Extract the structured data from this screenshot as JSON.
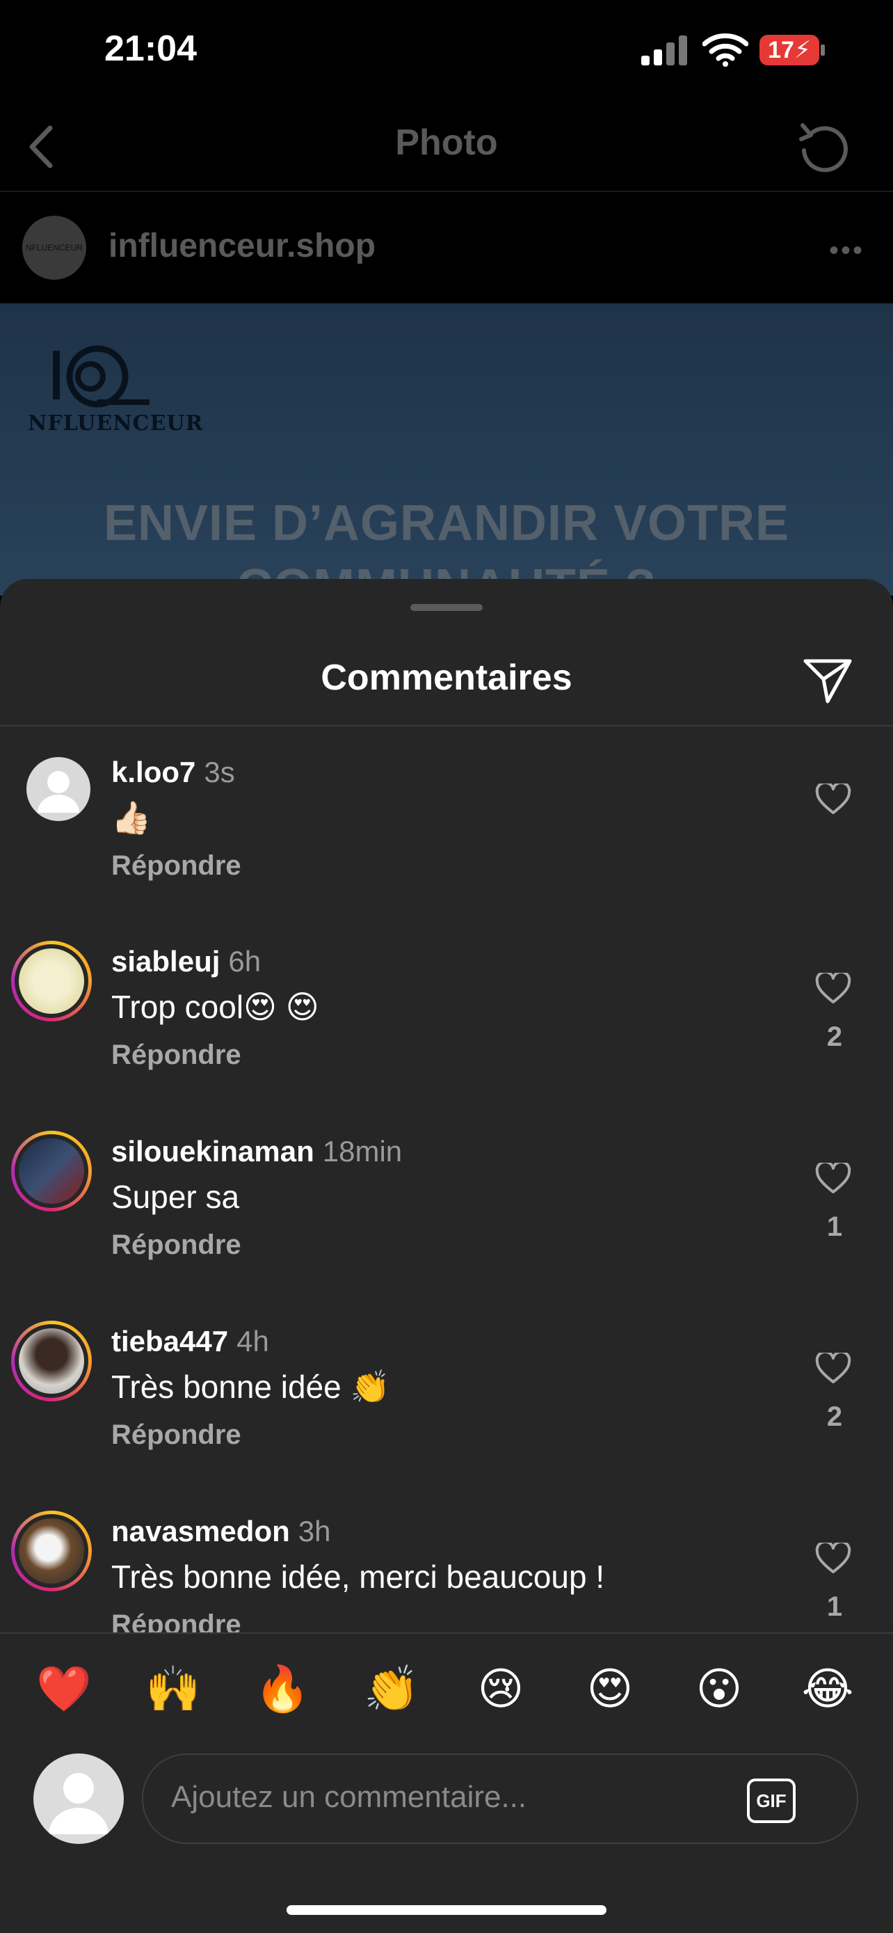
{
  "status": {
    "time": "21:04",
    "battery": "17"
  },
  "nav": {
    "title": "Photo"
  },
  "post": {
    "username": "influenceur.shop",
    "avatar_text": "NFLUENCEUR",
    "brand": "NFLUENCEUR",
    "headline_1": "ENVIE D’AGRANDIR VOTRE",
    "headline_2": "COMMUNAUTÉ ?"
  },
  "sheet": {
    "title": "Commentaires"
  },
  "comments": [
    {
      "user": "k.loo7",
      "time": "3s",
      "text": "👍🏻",
      "reply": "Répondre",
      "likes": ""
    },
    {
      "user": "siableuj",
      "time": "6h",
      "text": "Trop cool😍 😍",
      "reply": "Répondre",
      "likes": "2"
    },
    {
      "user": "silouekinaman",
      "time": "18min",
      "text": "Super sa",
      "reply": "Répondre",
      "likes": "1"
    },
    {
      "user": "tieba447",
      "time": "4h",
      "text": "Très bonne idée 👏",
      "reply": "Répondre",
      "likes": "2"
    },
    {
      "user": "navasmedon",
      "time": "3h",
      "text": "Très bonne idée, merci beaucoup !",
      "reply": "Répondre",
      "likes": "1"
    }
  ],
  "emojis": [
    "❤️",
    "🙌",
    "🔥",
    "👏",
    "😢",
    "😍",
    "😮",
    "😂"
  ],
  "composer": {
    "placeholder": "Ajoutez un commentaire...",
    "gif": "GIF"
  },
  "colors": {
    "sheet_bg": "#262626",
    "accent_ring": "#d62977",
    "battery": "#e53935"
  }
}
